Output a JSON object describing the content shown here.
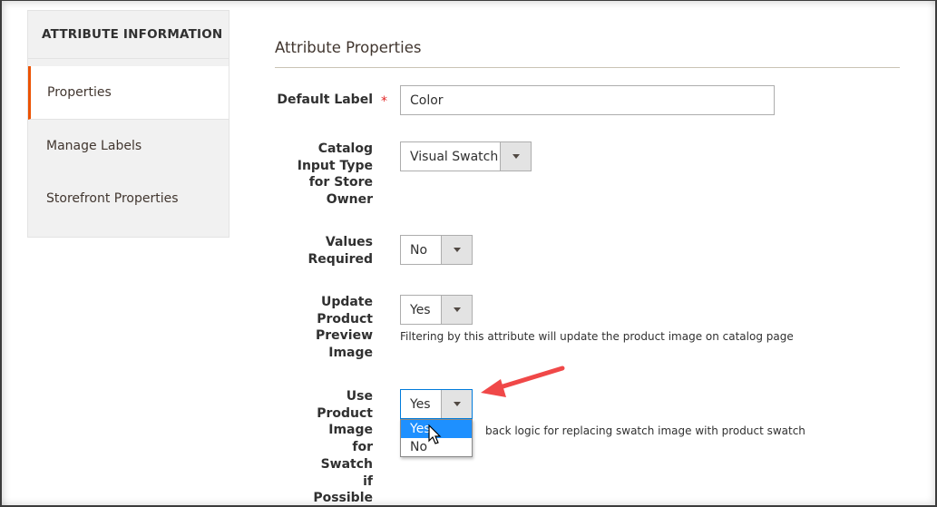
{
  "sidebar": {
    "title": "ATTRIBUTE INFORMATION",
    "items": [
      {
        "label": "Properties",
        "active": true
      },
      {
        "label": "Manage Labels",
        "active": false
      },
      {
        "label": "Storefront Properties",
        "active": false
      }
    ]
  },
  "main": {
    "section_title": "Attribute Properties",
    "fields": {
      "default_label": {
        "label": "Default Label",
        "required_mark": "*",
        "value": "Color"
      },
      "catalog_input_type": {
        "label": "Catalog Input Type for Store Owner",
        "value": "Visual Swatch"
      },
      "values_required": {
        "label": "Values Required",
        "value": "No"
      },
      "update_product_preview_image": {
        "label": "Update Product Preview Image",
        "value": "Yes",
        "note": "Filtering by this attribute will update the product image on catalog page"
      },
      "use_product_image_for_swatch": {
        "label": "Use Product Image for Swatch if Possible",
        "value": "Yes",
        "note_visible": "back logic for replacing swatch image with product swatch",
        "options": [
          "Yes",
          "No"
        ],
        "highlighted_option": "Yes"
      }
    }
  },
  "colors": {
    "accent": "#eb5202",
    "required": "#e22626",
    "focus": "#007bdb",
    "highlight": "#1e90ff",
    "annotation_arrow": "#f04848"
  }
}
